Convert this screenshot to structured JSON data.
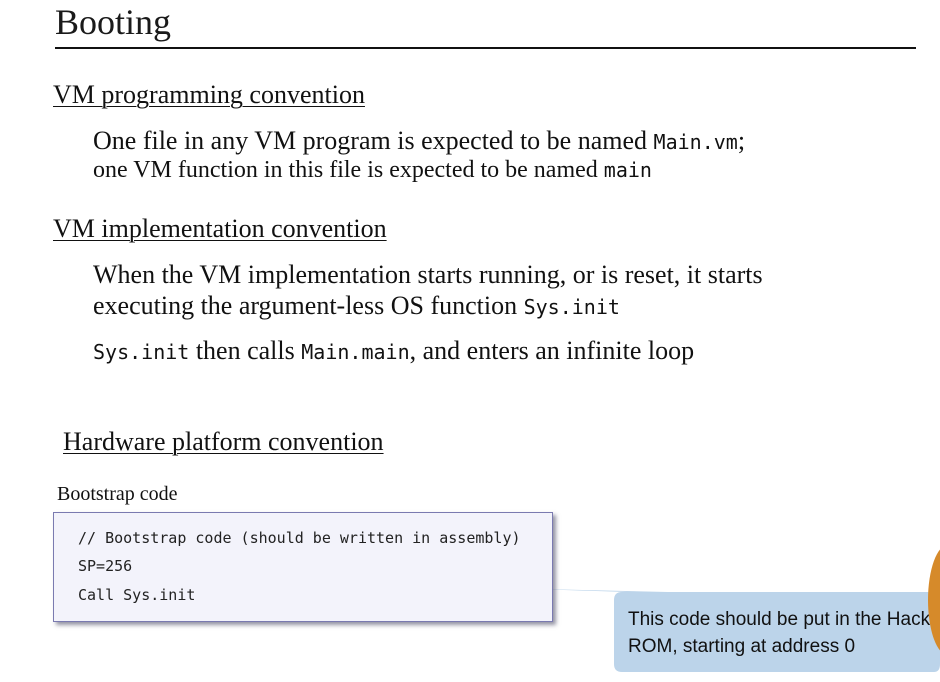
{
  "title": "Booting",
  "sections": {
    "vm_programming": {
      "heading": "VM programming convention",
      "line1_prefix": "One file in any VM program is expected to be named ",
      "line1_code": "Main.vm",
      "line1_suffix": ";",
      "line2_prefix": "one VM function in this file is expected to be named ",
      "line2_code": "main"
    },
    "vm_implementation": {
      "heading": "VM implementation convention",
      "line1": "When the VM implementation starts running, or is reset, it starts",
      "line2_prefix": "executing the argument-less OS function ",
      "line2_code": "Sys.init",
      "line3_code1": "Sys.init",
      "line3_mid": " then calls ",
      "line3_code2": "Main.main",
      "line3_suffix": ", and enters an infinite loop"
    },
    "hardware": {
      "heading": "Hardware platform convention",
      "code_label": "Bootstrap code",
      "code_lines": [
        "// Bootstrap code (should be written in assembly)",
        "SP=256",
        "Call Sys.init"
      ],
      "callout": "This code should be put in the Hack ROM, starting at address 0"
    }
  },
  "colors": {
    "callout_bg": "#bcd4ea",
    "code_bg": "#f3f3fb",
    "code_border": "#7a7ab0"
  }
}
